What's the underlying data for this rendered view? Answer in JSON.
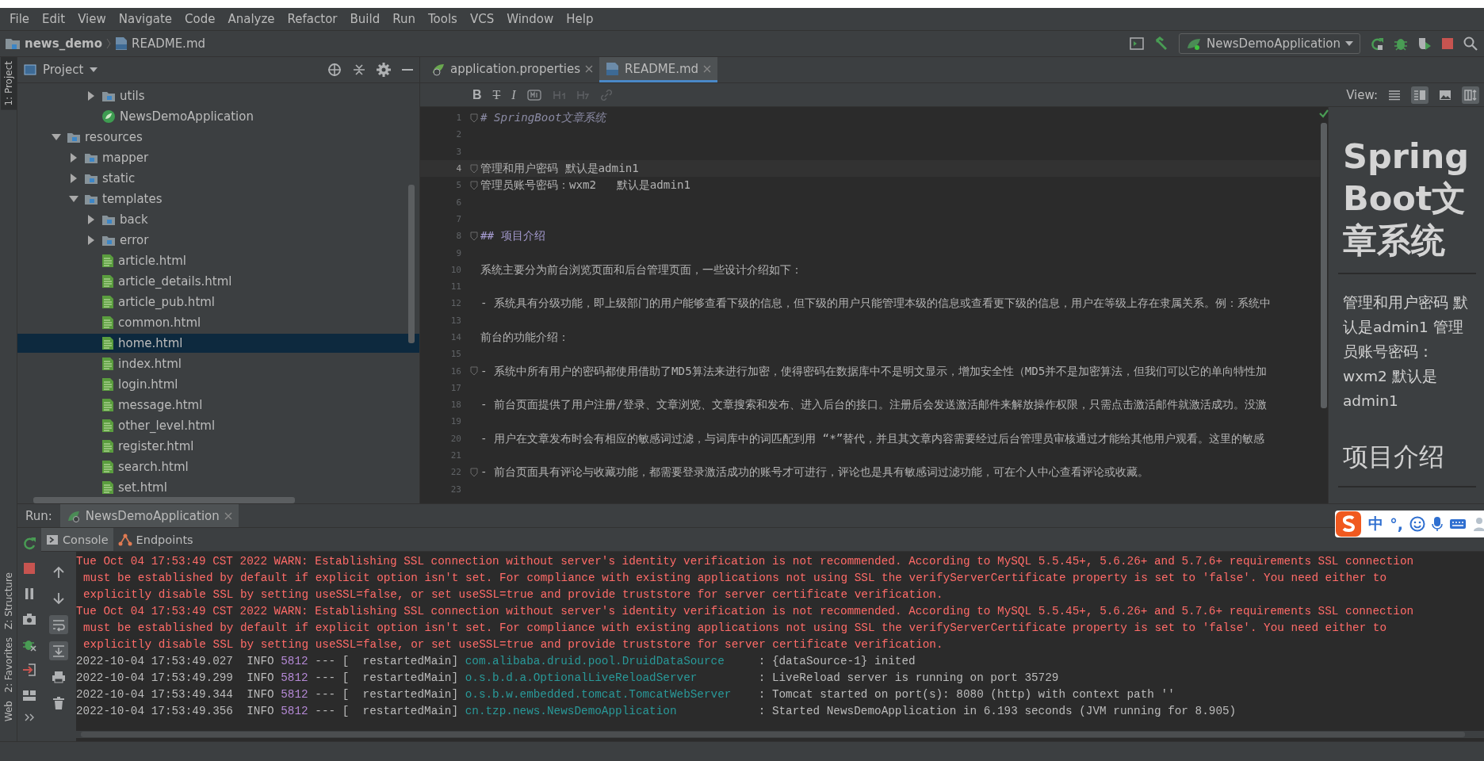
{
  "menu": [
    "File",
    "Edit",
    "View",
    "Navigate",
    "Code",
    "Analyze",
    "Refactor",
    "Build",
    "Run",
    "Tools",
    "VCS",
    "Window",
    "Help"
  ],
  "breadcrumb": [
    "news_demo",
    "README.md"
  ],
  "run_config": {
    "label": "NewsDemoApplication"
  },
  "tool_windows_top": [
    {
      "label": "1: Project",
      "selected": true
    }
  ],
  "tool_windows_bottom": [
    {
      "label": "Z: Structure",
      "selected": false
    },
    {
      "label": "2: Favorites",
      "selected": false
    },
    {
      "label": "Web",
      "selected": false
    }
  ],
  "project": {
    "title": "Project",
    "tree": [
      {
        "kind": "group",
        "children": [
          {
            "kind": "group",
            "children": [
              {
                "kind": "folder",
                "label": "utils",
                "expanded": false,
                "selected": false
              },
              {
                "kind": "class",
                "label": "NewsDemoApplication",
                "selected": false
              }
            ]
          }
        ]
      },
      {
        "kind": "folder",
        "label": "resources",
        "expanded": true,
        "selected": false,
        "children": [
          {
            "kind": "folder",
            "label": "mapper",
            "expanded": false,
            "selected": false
          },
          {
            "kind": "folder",
            "label": "static",
            "expanded": false,
            "selected": false
          },
          {
            "kind": "folder",
            "label": "templates",
            "expanded": true,
            "selected": false,
            "children": [
              {
                "kind": "folder",
                "label": "back",
                "expanded": false,
                "selected": false
              },
              {
                "kind": "folder",
                "label": "error",
                "expanded": false,
                "selected": false
              },
              {
                "kind": "html",
                "label": "article.html",
                "selected": false
              },
              {
                "kind": "html",
                "label": "article_details.html",
                "selected": false
              },
              {
                "kind": "html",
                "label": "article_pub.html",
                "selected": false
              },
              {
                "kind": "html",
                "label": "common.html",
                "selected": false
              },
              {
                "kind": "html",
                "label": "home.html",
                "selected": true
              },
              {
                "kind": "html",
                "label": "index.html",
                "selected": false
              },
              {
                "kind": "html",
                "label": "login.html",
                "selected": false
              },
              {
                "kind": "html",
                "label": "message.html",
                "selected": false
              },
              {
                "kind": "html",
                "label": "other_level.html",
                "selected": false
              },
              {
                "kind": "html",
                "label": "register.html",
                "selected": false
              },
              {
                "kind": "html",
                "label": "search.html",
                "selected": false
              },
              {
                "kind": "html",
                "label": "set.html",
                "selected": false
              }
            ]
          }
        ]
      }
    ]
  },
  "editor": {
    "tabs": [
      {
        "kind": "properties",
        "label": "application.properties",
        "selected": false
      },
      {
        "kind": "markdown",
        "label": "README.md",
        "selected": true
      }
    ],
    "format_buttons": [
      "B",
      "T",
      "I"
    ],
    "view_label": "View:",
    "lines": [
      {
        "number": "1",
        "kind": "h1",
        "text": "# SpringBoot文章系统",
        "fold": true,
        "current": false
      },
      {
        "number": "2",
        "kind": "blank",
        "fold": false,
        "current": false
      },
      {
        "number": "3",
        "kind": "blank",
        "fold": false,
        "current": false
      },
      {
        "number": "4",
        "kind": "text",
        "text": "管理和用户密码 默认是admin1",
        "fold": true,
        "current": true
      },
      {
        "number": "5",
        "kind": "text",
        "text": "管理员账号密码：wxm2   默认是admin1",
        "fold": true,
        "current": false
      },
      {
        "number": "6",
        "kind": "blank",
        "fold": false,
        "current": false
      },
      {
        "number": "7",
        "kind": "blank",
        "fold": false,
        "current": false
      },
      {
        "number": "8",
        "kind": "h2",
        "text": "## 项目介绍",
        "fold": true,
        "current": false
      },
      {
        "number": "9",
        "kind": "blank",
        "fold": false,
        "current": false
      },
      {
        "number": "10",
        "kind": "text",
        "text": "系统主要分为前台浏览页面和后台管理页面，一些设计介绍如下：",
        "fold": false,
        "current": false
      },
      {
        "number": "11",
        "kind": "blank",
        "fold": false,
        "current": false
      },
      {
        "number": "12",
        "kind": "text",
        "text": "- 系统具有分级功能，即上级部门的用户能够查看下级的信息，但下级的用户只能管理本级的信息或查看更下级的信息，用户在等级上存在隶属关系。例：系统中",
        "fold": false,
        "current": false
      },
      {
        "number": "13",
        "kind": "blank",
        "fold": false,
        "current": false
      },
      {
        "number": "14",
        "kind": "text",
        "text": "前台的功能介绍：",
        "fold": false,
        "current": false
      },
      {
        "number": "15",
        "kind": "blank",
        "fold": false,
        "current": false
      },
      {
        "number": "16",
        "kind": "text",
        "text": "- 系统中所有用户的密码都使用借助了MD5算法来进行加密，使得密码在数据库中不是明文显示，增加安全性（MD5并不是加密算法，但我们可以它的单向特性加",
        "fold": true,
        "current": false
      },
      {
        "number": "17",
        "kind": "blank",
        "fold": false,
        "current": false
      },
      {
        "number": "18",
        "kind": "text",
        "text": "- 前台页面提供了用户注册/登录、文章浏览、文章搜索和发布、进入后台的接口。注册后会发送激活邮件来解放操作权限，只需点击激活邮件就激活成功。没激",
        "fold": false,
        "current": false
      },
      {
        "number": "19",
        "kind": "blank",
        "fold": false,
        "current": false
      },
      {
        "number": "20",
        "kind": "text",
        "text": "- 用户在文章发布时会有相应的敏感词过滤，与词库中的词匹配到用 “*”替代，并且其文章内容需要经过后台管理员审核通过才能给其他用户观看。这里的敏感",
        "fold": false,
        "current": false
      },
      {
        "number": "21",
        "kind": "blank",
        "fold": false,
        "current": false
      },
      {
        "number": "22",
        "kind": "text",
        "text": "- 前台页面具有评论与收藏功能，都需要登录激活成功的账号才可进行，评论也是具有敏感词过滤功能，可在个人中心查看评论或收藏。",
        "fold": true,
        "current": false
      },
      {
        "number": "23",
        "kind": "blank",
        "fold": false,
        "current": false
      }
    ]
  },
  "preview": {
    "heading": "Spring Boot文章系统",
    "paragraph": "管理和用户密码 默认是admin1 管理员账号密码：wxm2 默认是admin1",
    "subheading": "项目介绍"
  },
  "run": {
    "label": "Run:",
    "tab": {
      "label": "NewsDemoApplication"
    },
    "subtabs": [
      {
        "kind": "console",
        "label": "Console",
        "selected": true
      },
      {
        "kind": "endpoints",
        "label": "Endpoints",
        "selected": false
      }
    ],
    "console": [
      {
        "kind": "warn",
        "lines": [
          "Tue Oct 04 17:53:49 CST 2022 WARN: Establishing SSL connection without server's identity verification is not recommended. According to MySQL 5.5.45+, 5.6.26+ and 5.7.6+ requirements SSL connection",
          "must be established by default if explicit option isn't set. For compliance with existing applications not using SSL the verifyServerCertificate property is set to 'false'. You need either to",
          "explicitly disable SSL by setting useSSL=false, or set useSSL=true and provide truststore for server certificate verification."
        ]
      },
      {
        "kind": "warn",
        "lines": [
          "Tue Oct 04 17:53:49 CST 2022 WARN: Establishing SSL connection without server's identity verification is not recommended. According to MySQL 5.5.45+, 5.6.26+ and 5.7.6+ requirements SSL connection",
          "must be established by default if explicit option isn't set. For compliance with existing applications not using SSL the verifyServerCertificate property is set to 'false'. You need either to",
          "explicitly disable SSL by setting useSSL=false, or set useSSL=true and provide truststore for server certificate verification."
        ]
      },
      {
        "kind": "info",
        "time": "2022-10-04 17:53:49.027",
        "level": "INFO",
        "pid": "5812",
        "separator": "---",
        "thread": "[  restartedMain]",
        "logger": "com.alibaba.druid.pool.DruidDataSource",
        "message": ": {dataSource-1} inited"
      },
      {
        "kind": "info",
        "time": "2022-10-04 17:53:49.299",
        "level": "INFO",
        "pid": "5812",
        "separator": "---",
        "thread": "[  restartedMain]",
        "logger": "o.s.b.d.a.OptionalLiveReloadServer",
        "message": ": LiveReload server is running on port 35729"
      },
      {
        "kind": "info",
        "time": "2022-10-04 17:53:49.344",
        "level": "INFO",
        "pid": "5812",
        "separator": "---",
        "thread": "[  restartedMain]",
        "logger": "o.s.b.w.embedded.tomcat.TomcatWebServer",
        "message": ": Tomcat started on port(s): 8080 (http) with context path ''"
      },
      {
        "kind": "info",
        "time": "2022-10-04 17:53:49.356",
        "level": "INFO",
        "pid": "5812",
        "separator": "---",
        "thread": "[  restartedMain]",
        "logger": "cn.tzp.news.NewsDemoApplication",
        "message": ": Started NewsDemoApplication in 6.193 seconds (JVM running for 8.905)"
      }
    ]
  },
  "ime": {
    "labels": [
      "中",
      "°,"
    ]
  }
}
